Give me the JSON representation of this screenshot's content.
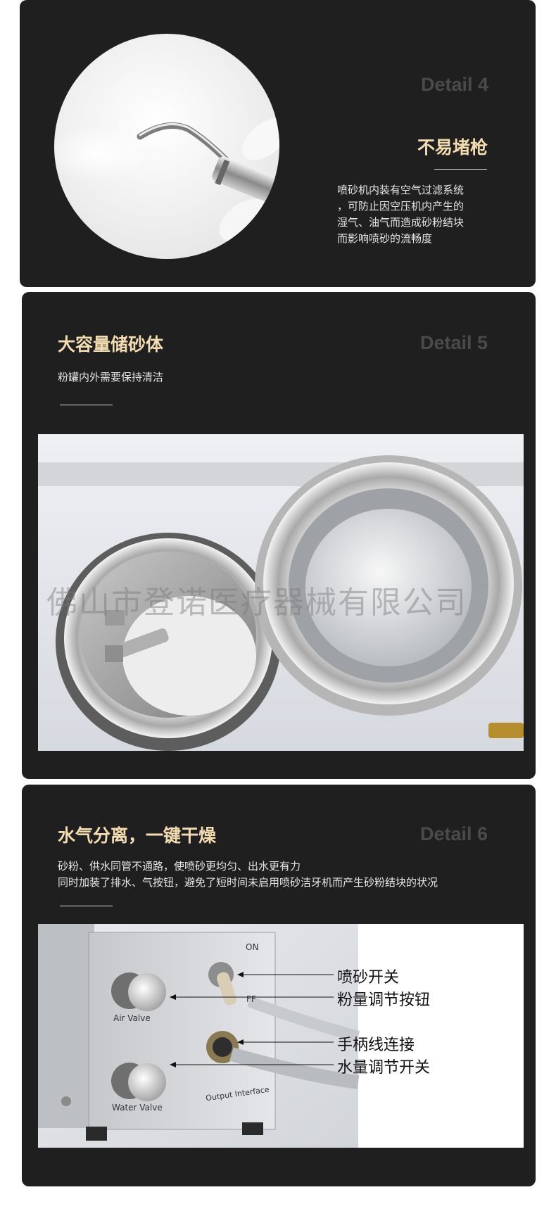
{
  "sections": [
    {
      "detail": "Detail 4",
      "title": "不易堵枪",
      "description_lines": [
        "喷砂机内装有空气过滤系统",
        "，可防止因空压机内产生的",
        "湿气、油气而造成砂粉结块",
        "而影响喷砂的流畅度"
      ]
    },
    {
      "detail": "Detail 5",
      "title": "大容量储砂体",
      "description_lines": [
        "粉罐内外需要保持清洁"
      ],
      "watermark": "佛山市登诺医疗器械有限公司"
    },
    {
      "detail": "Detail 6",
      "title": "水气分离，一键干燥",
      "description_lines": [
        "砂粉、供水同管不通路，使喷砂更均匀、出水更有力",
        "同时加装了排水、气按钮，避免了短时间未启用喷砂洁牙机而产生砂粉结块的状况"
      ],
      "device_labels": {
        "on": "ON",
        "off": "FF",
        "air_valve": "Air Valve",
        "water_valve": "Water Valve",
        "output_interface": "Output Interface"
      },
      "callouts": [
        "喷砂开关",
        "粉量调节按钮",
        "手柄线连接",
        "水量调节开关"
      ]
    }
  ]
}
